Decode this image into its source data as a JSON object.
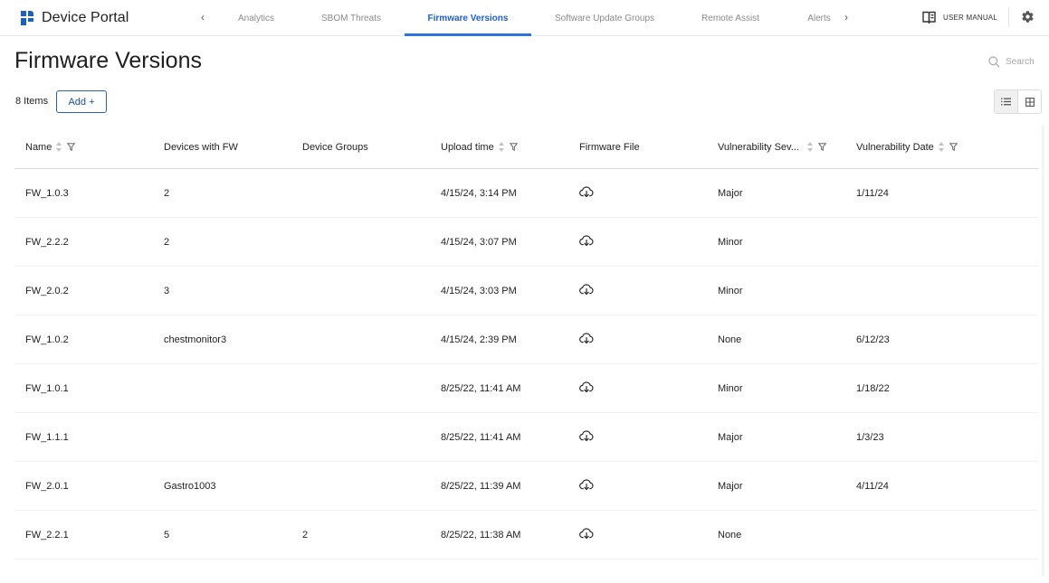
{
  "app": {
    "title": "Device Portal"
  },
  "nav": {
    "tabs": [
      {
        "label": "Analytics",
        "active": false
      },
      {
        "label": "SBOM Threats",
        "active": false
      },
      {
        "label": "Firmware Versions",
        "active": true
      },
      {
        "label": "Software Update Groups",
        "active": false
      },
      {
        "label": "Remote Assist",
        "active": false
      },
      {
        "label": "Alerts",
        "active": false
      }
    ],
    "prev_glyph": "‹",
    "next_glyph": "›"
  },
  "header": {
    "manual_label": "USER MANUAL"
  },
  "page": {
    "title": "Firmware Versions",
    "search_placeholder": "Search",
    "count_label": "8 Items",
    "add_label": "Add +"
  },
  "table": {
    "columns": [
      {
        "label": "Name",
        "sortable": true,
        "filterable": true
      },
      {
        "label": "Devices with FW",
        "sortable": false,
        "filterable": false
      },
      {
        "label": "Device Groups",
        "sortable": false,
        "filterable": false
      },
      {
        "label": "Upload time",
        "sortable": true,
        "filterable": true
      },
      {
        "label": "Firmware File",
        "sortable": false,
        "filterable": false
      },
      {
        "label": "Vulnerability Sev...",
        "sortable": true,
        "filterable": true
      },
      {
        "label": "Vulnerability Date",
        "sortable": true,
        "filterable": true
      }
    ],
    "rows": [
      {
        "name": "FW_1.0.3",
        "devices": "2",
        "groups": "",
        "upload": "4/15/24, 3:14 PM",
        "severity": "Major",
        "vdate": "1/11/24"
      },
      {
        "name": "FW_2.2.2",
        "devices": "2",
        "groups": "",
        "upload": "4/15/24, 3:07 PM",
        "severity": "Minor",
        "vdate": ""
      },
      {
        "name": "FW_2.0.2",
        "devices": "3",
        "groups": "",
        "upload": "4/15/24, 3:03 PM",
        "severity": "Minor",
        "vdate": ""
      },
      {
        "name": "FW_1.0.2",
        "devices": "chestmonitor3",
        "groups": "",
        "upload": "4/15/24, 2:39 PM",
        "severity": "None",
        "vdate": "6/12/23"
      },
      {
        "name": "FW_1.0.1",
        "devices": "",
        "groups": "",
        "upload": "8/25/22, 11:41 AM",
        "severity": "Minor",
        "vdate": "1/18/22"
      },
      {
        "name": "FW_1.1.1",
        "devices": "",
        "groups": "",
        "upload": "8/25/22, 11:41 AM",
        "severity": "Major",
        "vdate": "1/3/23"
      },
      {
        "name": "FW_2.0.1",
        "devices": "Gastro1003",
        "groups": "",
        "upload": "8/25/22, 11:39 AM",
        "severity": "Major",
        "vdate": "4/11/24"
      },
      {
        "name": "FW_2.2.1",
        "devices": "5",
        "groups": "2",
        "upload": "8/25/22, 11:38 AM",
        "severity": "None",
        "vdate": ""
      }
    ]
  },
  "icons": {
    "brand": "device-portal-logo",
    "manual": "book-icon",
    "settings": "gear-icon",
    "search": "search-icon",
    "list_view": "list-view-icon",
    "grid_view": "grid-view-icon",
    "download": "cloud-download-icon",
    "sort": "sort-icon",
    "filter": "filter-icon"
  },
  "colors": {
    "accent": "#1a5fd6",
    "brand": "#1f5fbf",
    "muted_text": "#8a8a8a"
  }
}
